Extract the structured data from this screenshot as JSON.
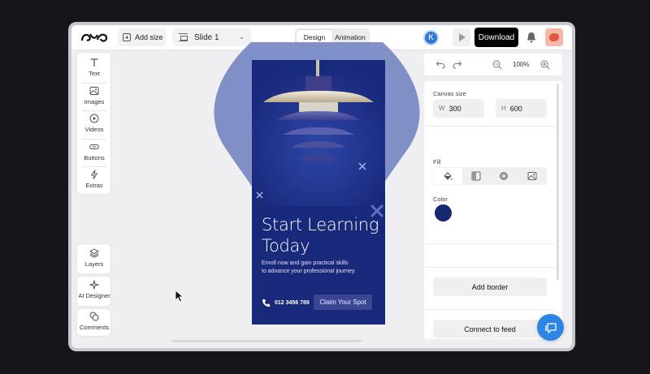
{
  "topbar": {
    "add_size_label": "Add size",
    "slide_select_value": "Slide 1",
    "tabs": [
      {
        "label": "Design",
        "active": true
      },
      {
        "label": "Animation",
        "active": false
      }
    ],
    "avatar_initial": "K",
    "download_label": "Download"
  },
  "left_tools": [
    {
      "label": "Text",
      "icon": "text-icon"
    },
    {
      "label": "Images",
      "icon": "image-icon"
    },
    {
      "label": "Videos",
      "icon": "video-icon"
    },
    {
      "label": "Buttons",
      "icon": "button-icon"
    },
    {
      "label": "Extras",
      "icon": "lightning-icon"
    }
  ],
  "bottom_tools": [
    {
      "label": "Layers",
      "icon": "layers-icon"
    },
    {
      "label": "AI Designer",
      "icon": "sparkle-icon"
    },
    {
      "label": "Comments",
      "icon": "comments-icon"
    }
  ],
  "slide": {
    "headline_line1": "Start Learning",
    "headline_line2": "Today",
    "subline_line1": "Enroll now and gain practical skills",
    "subline_line2": "to advance your professional journey.",
    "phone": "012 3456 789",
    "cta": "Claim Your Spot",
    "background_color": "#18287a"
  },
  "right_panel": {
    "zoom": "100%",
    "canvas_size_label": "Canvas size",
    "width_key": "W",
    "width_value": "300",
    "height_key": "H",
    "height_value": "600",
    "fill_label": "Fill",
    "fill_options": [
      "solid-fill-icon",
      "linear-gradient-icon",
      "radial-gradient-icon",
      "image-fill-icon"
    ],
    "color_label": "Color",
    "color_value": "#16286f",
    "add_border_label": "Add border",
    "connect_feed_label": "Connect to feed"
  },
  "colors": {
    "accent": "#2e86e4",
    "download_bg": "#000000"
  }
}
